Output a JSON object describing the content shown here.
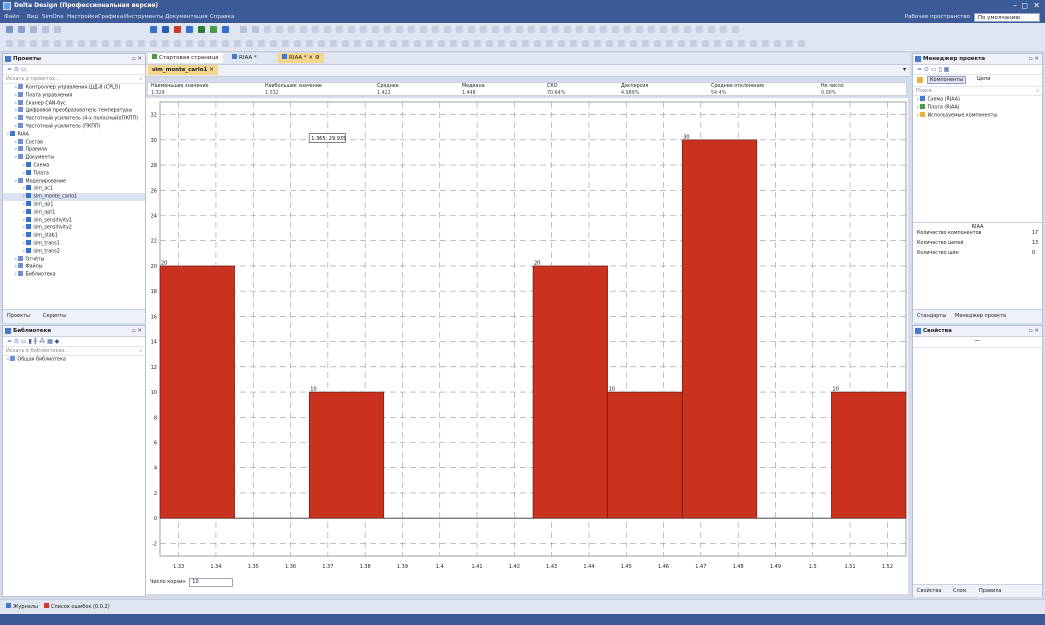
{
  "window": {
    "title": "Delta Design (Профессиональная версия)",
    "workspace_label": "Рабочее пространство",
    "workspace_value": "По умолчанию"
  },
  "menu": [
    "Файл",
    "Вид",
    "SimOne",
    "Настройки",
    "Графика",
    "Инструменты",
    "Документация",
    "Справка"
  ],
  "projects_panel": {
    "title": "Проекты",
    "search_placeholder": "Искать в проектах...",
    "tree": [
      {
        "label": "Контроллер управления ШД-8 (CPLD)",
        "indent": 1
      },
      {
        "label": "Плата управления",
        "indent": 1
      },
      {
        "label": "Сканер CAN-бус",
        "indent": 1
      },
      {
        "label": "Цифровой преобразователь температуры",
        "indent": 1
      },
      {
        "label": "Частотный усилитель (4-х полосный)(ПКПП)",
        "indent": 1
      },
      {
        "label": "Частотный усилитель (ПКПП)",
        "indent": 1
      },
      {
        "label": "RIAA",
        "indent": 0
      },
      {
        "label": "Состав",
        "indent": 1
      },
      {
        "label": "Правила",
        "indent": 1
      },
      {
        "label": "Документы",
        "indent": 1
      },
      {
        "label": "Схема",
        "indent": 2
      },
      {
        "label": "Плата",
        "indent": 2
      },
      {
        "label": "Моделирование",
        "indent": 1
      },
      {
        "label": "sim_ac1",
        "indent": 2
      },
      {
        "label": "sim_monte_carlo1",
        "indent": 2,
        "selected": true
      },
      {
        "label": "sim_op1",
        "indent": 2
      },
      {
        "label": "sim_opt1",
        "indent": 2
      },
      {
        "label": "sim_sensitivity1",
        "indent": 2
      },
      {
        "label": "sim_sensitivity2",
        "indent": 2
      },
      {
        "label": "sim_stab1",
        "indent": 2
      },
      {
        "label": "sim_trans1",
        "indent": 2
      },
      {
        "label": "sim_trans2",
        "indent": 2
      },
      {
        "label": "Отчёты",
        "indent": 1
      },
      {
        "label": "Файлы",
        "indent": 1
      },
      {
        "label": "Библиотека",
        "indent": 1
      }
    ],
    "bottom_tabs": [
      "Проекты",
      "Скрипты"
    ]
  },
  "library_panel": {
    "title": "Библиотеки",
    "search_placeholder": "Искать в библиотеках...",
    "items": [
      "Общая библиотека"
    ]
  },
  "doc_tabs": [
    "Стартовая страница",
    "RIAA *",
    "RIAA *"
  ],
  "sub_tab": "sim_monte_carlo1",
  "stats": {
    "headers": [
      "Наименьшее значение",
      "Наибольшее значение",
      "Среднее",
      "Медиана",
      "СКО",
      "Дисперсия",
      "Среднее отклонение",
      "Не число"
    ],
    "values": [
      "1.329",
      "1.532",
      "1.422",
      "1.448",
      "70.64%",
      "4.989%",
      "54.4%",
      "0.00%"
    ]
  },
  "chart_data": {
    "type": "bar",
    "bins": [
      {
        "from": 1.325,
        "to": 1.345,
        "value": 20
      },
      {
        "from": 1.365,
        "to": 1.385,
        "value": 10
      },
      {
        "from": 1.425,
        "to": 1.445,
        "value": 20
      },
      {
        "from": 1.445,
        "to": 1.465,
        "value": 10
      },
      {
        "from": 1.465,
        "to": 1.485,
        "value": 30
      },
      {
        "from": 1.505,
        "to": 1.525,
        "value": 10
      }
    ],
    "xlim": [
      1.325,
      1.525
    ],
    "ylim": [
      -3,
      33
    ],
    "xticks": [
      "1.33",
      "1.34",
      "1.35",
      "1.36",
      "1.37",
      "1.38",
      "1.39",
      "1.4",
      "1.41",
      "1.42",
      "1.43",
      "1.44",
      "1.45",
      "1.46",
      "1.47",
      "1.48",
      "1.49",
      "1.5",
      "1.51",
      "1.52",
      "1.53"
    ],
    "yticks": [
      -2,
      0,
      2,
      4,
      6,
      8,
      10,
      12,
      14,
      16,
      18,
      20,
      22,
      24,
      26,
      28,
      30,
      32
    ],
    "bar_color": "#c8321e",
    "tooltip": "1.365; 29.935",
    "grid": true
  },
  "bins_label": "Число корзин",
  "bins_value": "10",
  "project_manager": {
    "title": "Менеджер проекта",
    "buttons": [
      "Компоненты",
      "Цепи"
    ],
    "search_placeholder": "Поиск",
    "tree": [
      "Схема (RIAA)",
      "Плата (RIAA)",
      "Используемые компоненты"
    ],
    "summary_title": "RIAA",
    "summary": [
      {
        "label": "Количество компонентов",
        "value": "17"
      },
      {
        "label": "Количество цепей",
        "value": "13"
      },
      {
        "label": "Количество шин",
        "value": "0"
      }
    ],
    "tabs": [
      "Стандарты",
      "Менеджер проекта"
    ]
  },
  "properties": {
    "title": "Свойства",
    "value": "—",
    "bottom_tabs": [
      "Свойства",
      "Слои",
      "Правила"
    ]
  },
  "bottom_bar": {
    "journal": "Журналы",
    "errors": "Список ошибок (0.0.2)"
  },
  "colors": {
    "accent": "#3b5a96",
    "bar": "#c8321e"
  }
}
